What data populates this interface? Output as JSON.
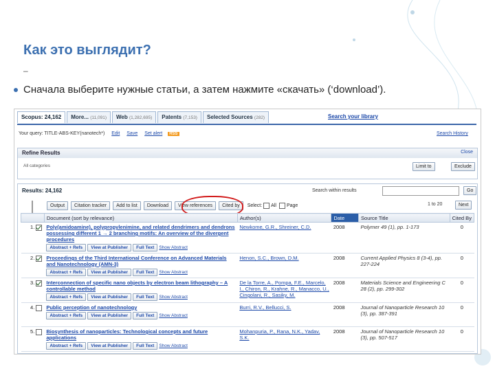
{
  "slide": {
    "title": "Как это выглядит?",
    "dash": "–",
    "bullet": "Сначала выберите нужные статьи, а затем нажмите «скачать» (‘download’)."
  },
  "tabs": [
    {
      "label": "Scopus: 24,162",
      "count": ""
    },
    {
      "label": "More...",
      "count": "(11,091)"
    },
    {
      "label": "Web",
      "count": "(1,282,695)"
    },
    {
      "label": "Patents",
      "count": "(7,153)"
    },
    {
      "label": "Selected Sources",
      "count": "(282)"
    }
  ],
  "search_library": "Search your library",
  "query": {
    "text": "Your query: TITLE-ABS-KEY(nanotech*)",
    "edit": "Edit",
    "save": "Save",
    "alert": "Set alert",
    "rss": "RSS",
    "history": "Search History"
  },
  "refine": {
    "title": "Refine Results",
    "close": "Close",
    "all_categories": "All categories",
    "limit_to": "Limit to",
    "exclude": "Exclude"
  },
  "results": {
    "count": "Results: 24,162",
    "within": "Search within results",
    "go": "Go",
    "toolbar": [
      "Output",
      "Citation tracker",
      "Add to list",
      "Download",
      "View references",
      "Cited by"
    ],
    "select": "Select:",
    "all": "All",
    "page": "Page",
    "page_info": "1 to 20",
    "next": "Next"
  },
  "columns": [
    "Document (sort by relevance)",
    "Author(s)",
    "Date",
    "Source Title",
    "Cited By"
  ],
  "rows": [
    {
      "num": "1.",
      "checked": true,
      "title": "Poly(amidoamine), polypropylenimine, and related dendrimers and dendrons possessing different 1 → 2 branching motifs: An overview of the divergent procedures",
      "authors": "Newkome, G.R., Shreiner, C.D.",
      "date": "2008",
      "source": "Polymer 49 (1), pp. 1-173",
      "cited": "0"
    },
    {
      "num": "2.",
      "checked": true,
      "title": "Proceedings of the Third International Conference on Advanced Materials and Nanotechnology (AMN-3)",
      "authors": "Henon, S.C., Brown, D.M.",
      "date": "2008",
      "source": "Current Applied Physics 8 (3-4), pp. 227-224",
      "cited": "0"
    },
    {
      "num": "3.",
      "checked": true,
      "title": "Interconnection of specific nano objects by electron beam lithography – A controllable method",
      "authors": "De la Torre, A., Pompa, F.E., Marcelo, I., Chiron, R., Krahne, R., Manacco, U., Cingolani, R., Sasiky, M.",
      "date": "2008",
      "source": "Materials Science and Engineering C 28 (2), pp. 299-302",
      "cited": "0"
    },
    {
      "num": "4.",
      "checked": false,
      "title": "Public perception of nanotechnology",
      "authors": "Burri, R.V., Bellucci, S.",
      "date": "2008",
      "source": "Journal of Nanoparticle Research 10 (3), pp. 387-391",
      "cited": "0"
    },
    {
      "num": "5.",
      "checked": false,
      "title": "Biosynthesis of nanoparticles: Technological concepts and future applications",
      "authors": "Mohanpuria, P., Rana, N.K., Yadav, S.K.",
      "date": "2008",
      "source": "Journal of Nanoparticle Research 10 (3), pp. 507-517",
      "cited": "0"
    }
  ],
  "row_links": {
    "abstract": "Abstract + Refs",
    "publisher": "View at Publisher",
    "fulltext": "Full Text",
    "show": "Show Abstract"
  },
  "colors": {
    "title": "#3b6fb0",
    "link": "#1a47a8",
    "highlight": "#d21b1b"
  }
}
